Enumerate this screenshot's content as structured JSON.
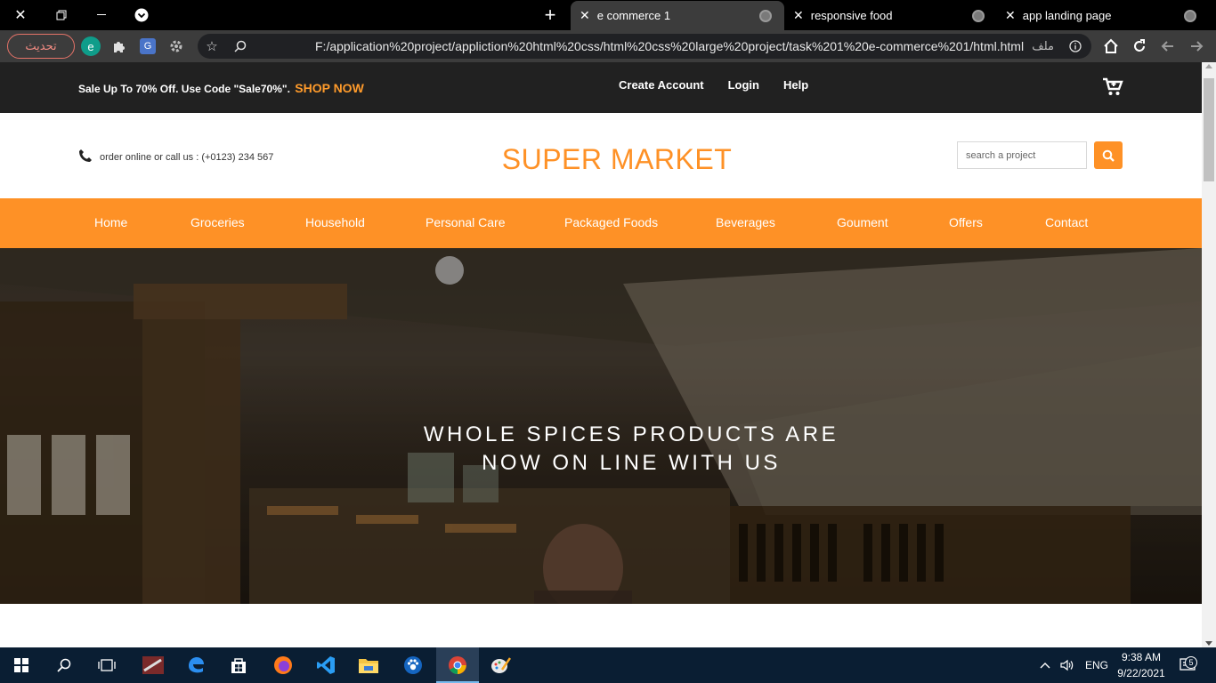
{
  "browser": {
    "tabs": [
      {
        "title": "e commerce 1",
        "active": true
      },
      {
        "title": "responsive food",
        "active": false
      },
      {
        "title": "app landing page",
        "active": false
      }
    ],
    "update_button": "تحديث",
    "extension_letter": "e",
    "translate_letter": "G",
    "url": "F:/application%20project/appliction%20html%20css/html%20css%20large%20project/task%201%20e-commerce%201/html.html",
    "scheme_label": "ملف"
  },
  "topbar": {
    "promo": "Sale Up To 70% Off. Use Code \"Sale70%\".",
    "shop_now": "SHOP NOW",
    "links": [
      "Create Account",
      "Login",
      "Help"
    ]
  },
  "header": {
    "phone_text": "order online or call us : (+0123) 234 567",
    "brand": "SUPER MARKET",
    "search_placeholder": "search a project"
  },
  "nav": {
    "items": [
      "Home",
      "Groceries",
      "Household",
      "Personal Care",
      "Packaged Foods",
      "Beverages",
      "Goument",
      "Offers",
      "Contact"
    ]
  },
  "hero": {
    "line1": "WHOLE SPICES PRODUCTS ARE",
    "line2": "NOW ON LINE WITH US"
  },
  "taskbar": {
    "language": "ENG",
    "time": "9:38 AM",
    "date": "9/22/2021",
    "notification_count": "5"
  },
  "colors": {
    "accent": "#fe9126",
    "topbar": "#212121",
    "taskbar": "#0a1e33"
  }
}
